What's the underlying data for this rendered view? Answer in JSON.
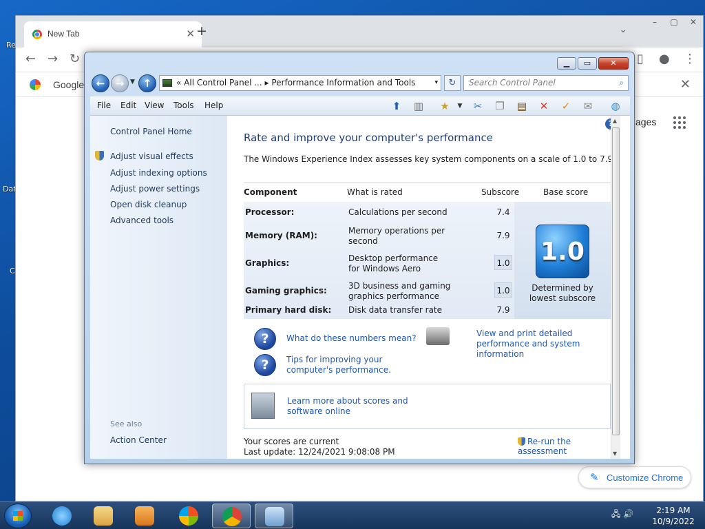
{
  "desktop": {
    "fragments": [
      "Re",
      "Dat",
      "C"
    ]
  },
  "chrome": {
    "tab_title": "New Tab",
    "tab_close": "✕",
    "new_tab": "+",
    "caption": {
      "minimize": "–",
      "maximize": "▢",
      "close": "✕"
    },
    "tab_search_chevron": "⌄",
    "bookmark_label": "Google",
    "bookmark_close": "✕",
    "images_link": "ages",
    "customize_label": "Customize Chrome",
    "customize_icon": "pencil-icon"
  },
  "window": {
    "caption": {
      "minimize": "▁",
      "maximize": "▭",
      "close": "✕"
    },
    "address": {
      "prefix": "«",
      "crumbs": "All Control Panel ...  ▸  Performance Information and Tools",
      "dropdown": "▾"
    },
    "refresh": "↻",
    "search_placeholder": "Search Control Panel",
    "menu": [
      "File",
      "Edit",
      "View",
      "Tools",
      "Help"
    ],
    "left_pane": {
      "tasks": [
        "Control Panel Home",
        "Adjust visual effects",
        "Adjust indexing options",
        "Adjust power settings",
        "Open disk cleanup",
        "Advanced tools"
      ],
      "see_also": "See also",
      "action_center": "Action Center"
    },
    "main": {
      "help": "?",
      "headline": "Rate and improve your computer's performance",
      "intro": "The Windows Experience Index assesses key system components on a scale of 1.0 to 7.9.",
      "headers": {
        "component": "Component",
        "rated": "What is rated",
        "subscore": "Subscore",
        "base": "Base score"
      },
      "rows": [
        {
          "component": "Processor:",
          "rated": "Calculations per second",
          "subscore": "7.4"
        },
        {
          "component": "Memory (RAM):",
          "rated": "Memory operations per second",
          "subscore": "7.9"
        },
        {
          "component": "Graphics:",
          "rated": "Desktop performance for Windows Aero",
          "subscore": "1.0"
        },
        {
          "component": "Gaming graphics:",
          "rated": "3D business and gaming graphics performance",
          "subscore": "1.0"
        },
        {
          "component": "Primary hard disk:",
          "rated": "Disk data transfer rate",
          "subscore": "7.9"
        }
      ],
      "base_score": "1.0",
      "base_caption": "Determined by lowest subscore",
      "q_mark": "?",
      "link_numbers": "What do these numbers mean?",
      "link_tips": "Tips for improving your computer's performance.",
      "link_print": "View and print detailed performance and system information",
      "link_learn": "Learn more about scores and software online",
      "status_current": "Your scores are current",
      "status_update": "Last update: 12/24/2021 9:08:08 PM",
      "rerun": "Re-run the assessment"
    }
  },
  "taskbar": {
    "tray_icons": "🖧 🔊",
    "time": "2:19 AM",
    "date": "10/9/2022"
  }
}
